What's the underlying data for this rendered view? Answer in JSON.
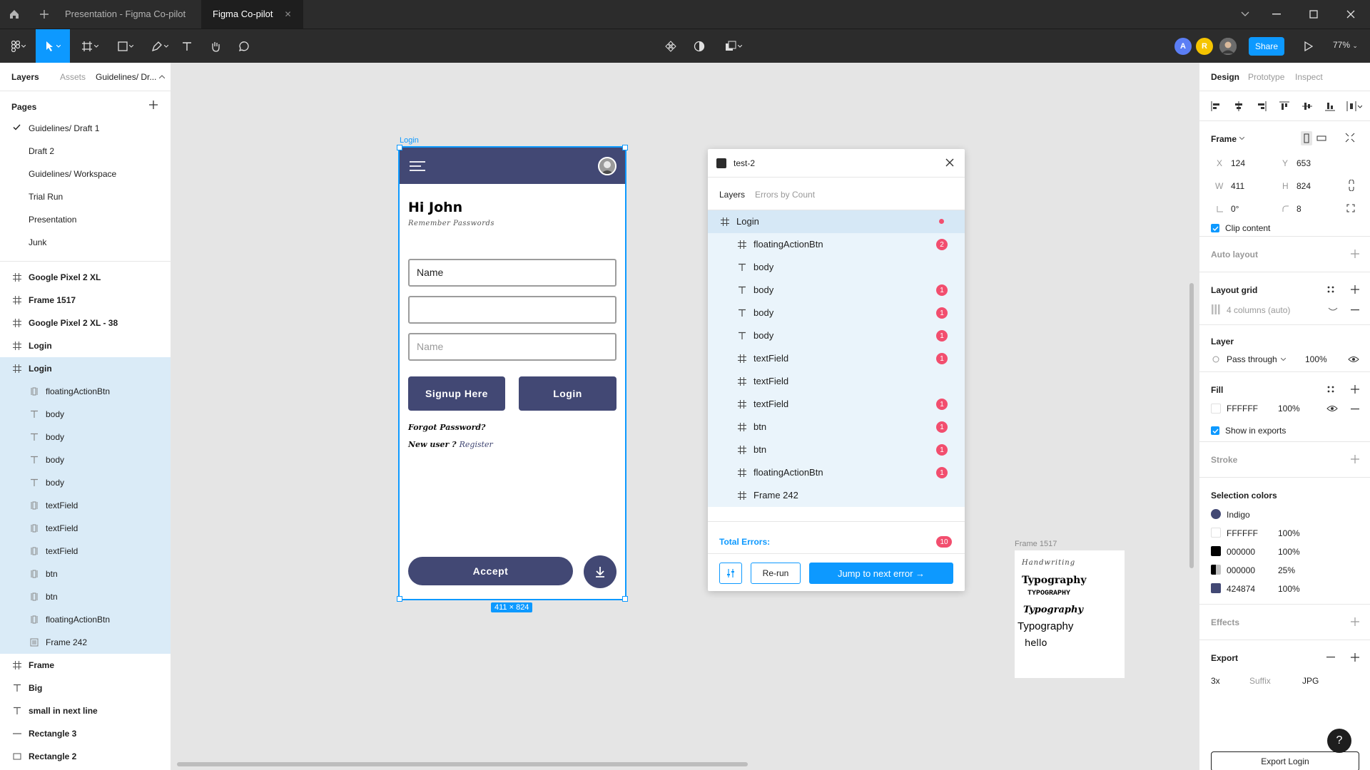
{
  "titlebar": {
    "tabs": [
      "Presentation - Figma Co-pilot",
      "Figma Co-pilot"
    ]
  },
  "toolbar": {
    "avatars": [
      {
        "label": "A",
        "color": "#5b7ef5"
      },
      {
        "label": "R",
        "color": "#f5c400"
      }
    ],
    "share_label": "Share",
    "zoom": "77%"
  },
  "left": {
    "tabs": [
      "Layers",
      "Assets"
    ],
    "page_selector": "Guidelines/ Dr...",
    "pages_header": "Pages",
    "pages": [
      "Guidelines/ Draft 1",
      "Draft 2",
      "Guidelines/ Workspace",
      "Trial Run",
      "Presentation",
      "Junk"
    ],
    "layers": [
      {
        "name": "Google Pixel 2 XL",
        "icon": "frame-icon"
      },
      {
        "name": "Frame 1517",
        "icon": "frame-icon"
      },
      {
        "name": "Google Pixel 2 XL - 38",
        "icon": "frame-icon"
      },
      {
        "name": "Login",
        "icon": "frame-icon"
      },
      {
        "name": "Login",
        "icon": "frame-icon"
      },
      {
        "name": "floatingActionBtn",
        "icon": "component-icon"
      },
      {
        "name": "body",
        "icon": "text-icon"
      },
      {
        "name": "body",
        "icon": "text-icon"
      },
      {
        "name": "body",
        "icon": "text-icon"
      },
      {
        "name": "body",
        "icon": "text-icon"
      },
      {
        "name": "textField",
        "icon": "component-icon"
      },
      {
        "name": "textField",
        "icon": "component-icon"
      },
      {
        "name": "textField",
        "icon": "component-icon"
      },
      {
        "name": "btn",
        "icon": "component-icon"
      },
      {
        "name": "btn",
        "icon": "component-icon"
      },
      {
        "name": "floatingActionBtn",
        "icon": "component-icon"
      },
      {
        "name": "Frame 242",
        "icon": "autolayout-icon"
      },
      {
        "name": "Frame",
        "icon": "frame-icon"
      },
      {
        "name": "Big",
        "icon": "text-icon"
      },
      {
        "name": "small in next line",
        "icon": "text-icon"
      },
      {
        "name": "Rectangle 3",
        "icon": "line-icon"
      },
      {
        "name": "Rectangle 2",
        "icon": "rect-icon"
      }
    ]
  },
  "canvas": {
    "phone_label": "Login",
    "phone": {
      "greeting": "Hi John",
      "subtitle": "Remember Passwords",
      "inputs": [
        "Name",
        "",
        ""
      ],
      "input_placeholder": "Name",
      "signup_label": "Signup Here",
      "login_label": "Login",
      "forgot": "Forgot Password?",
      "new_user": "New user ?",
      "register": "Register",
      "accept_label": "Accept"
    },
    "dimension_badge": "411 × 824",
    "frame1517_label": "Frame 1517",
    "frame1517": {
      "items": [
        "Handwriting",
        "Typography",
        "TYPOGRAPHY",
        "Typography",
        "Typography",
        "hello"
      ]
    }
  },
  "plugin": {
    "title": "test-2",
    "tabs": [
      "Layers",
      "Errors by Count"
    ],
    "rows": [
      {
        "name": "Login",
        "icon": "frame",
        "errors": "",
        "dot": true
      },
      {
        "name": "floatingActionBtn",
        "icon": "frame",
        "errors": "2"
      },
      {
        "name": "body",
        "icon": "text",
        "errors": ""
      },
      {
        "name": "body",
        "icon": "text",
        "errors": "1"
      },
      {
        "name": "body",
        "icon": "text",
        "errors": "1"
      },
      {
        "name": "body",
        "icon": "text",
        "errors": "1"
      },
      {
        "name": "textField",
        "icon": "frame",
        "errors": "1"
      },
      {
        "name": "textField",
        "icon": "frame",
        "errors": ""
      },
      {
        "name": "textField",
        "icon": "frame",
        "errors": "1"
      },
      {
        "name": "btn",
        "icon": "frame",
        "errors": "1"
      },
      {
        "name": "btn",
        "icon": "frame",
        "errors": "1"
      },
      {
        "name": "floatingActionBtn",
        "icon": "frame",
        "errors": "1"
      },
      {
        "name": "Frame 242",
        "icon": "frame",
        "errors": ""
      }
    ],
    "total_label": "Total Errors:",
    "total": "10",
    "rerun_label": "Re-run",
    "next_label": "Jump to next error →"
  },
  "right": {
    "tabs": [
      "Design",
      "Prototype",
      "Inspect"
    ],
    "frame_label": "Frame",
    "x_label": "X",
    "x": "124",
    "y_label": "Y",
    "y": "653",
    "w_label": "W",
    "w": "411",
    "h_label": "H",
    "h": "824",
    "rotation": "0°",
    "radius": "8",
    "clip_content": "Clip content",
    "auto_layout": "Auto layout",
    "layout_grid": "Layout grid",
    "grid_value": "4 columns (auto)",
    "layer": "Layer",
    "blend": "Pass through",
    "opacity": "100%",
    "fill": "Fill",
    "fill_hex": "FFFFFF",
    "fill_opacity": "100%",
    "show_exports": "Show in exports",
    "stroke": "Stroke",
    "selection_colors": "Selection colors",
    "colors": [
      {
        "name": "Indigo",
        "swatch": "#424874",
        "round": true,
        "opacity": ""
      },
      {
        "name": "FFFFFF",
        "swatch": "#ffffff",
        "round": false,
        "opacity": "100%"
      },
      {
        "name": "000000",
        "swatch": "#000000",
        "round": false,
        "opacity": "100%"
      },
      {
        "name": "000000",
        "swatch": "#000000",
        "round": false,
        "opacity": "25%"
      },
      {
        "name": "424874",
        "swatch": "#424874",
        "round": false,
        "opacity": "100%"
      }
    ],
    "effects": "Effects",
    "export": "Export",
    "export_scale": "3x",
    "export_suffix": "Suffix",
    "export_format": "JPG",
    "export_button": "Export Login",
    "help": "?"
  },
  "colors": {
    "accent": "#0d99ff",
    "indigo": "#424874",
    "error": "#f24e6e",
    "toolbar": "#2c2c2c"
  }
}
